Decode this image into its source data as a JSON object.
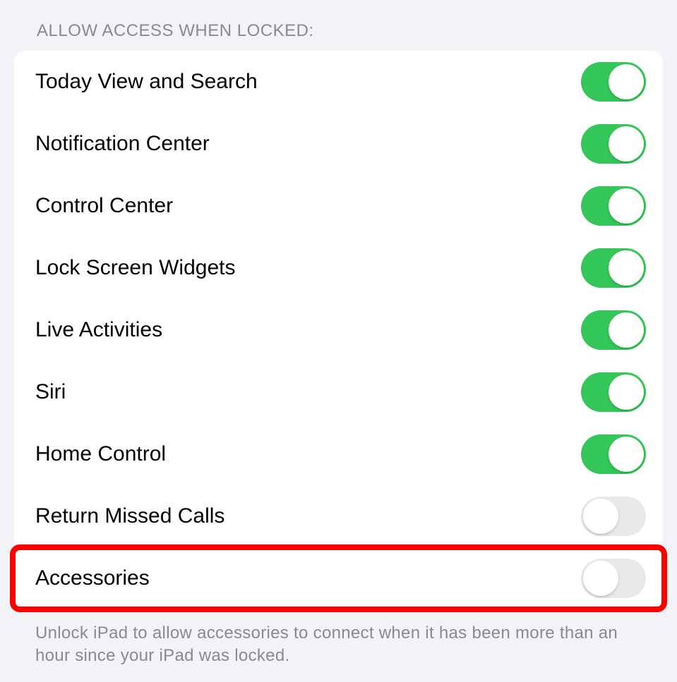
{
  "section": {
    "header": "ALLOW ACCESS WHEN LOCKED:",
    "footer": "Unlock iPad to allow accessories to connect when it has been more than an hour since your iPad was locked.",
    "items": [
      {
        "label": "Today View and Search",
        "enabled": true,
        "highlighted": false
      },
      {
        "label": "Notification Center",
        "enabled": true,
        "highlighted": false
      },
      {
        "label": "Control Center",
        "enabled": true,
        "highlighted": false
      },
      {
        "label": "Lock Screen Widgets",
        "enabled": true,
        "highlighted": false
      },
      {
        "label": "Live Activities",
        "enabled": true,
        "highlighted": false
      },
      {
        "label": "Siri",
        "enabled": true,
        "highlighted": false
      },
      {
        "label": "Home Control",
        "enabled": true,
        "highlighted": false
      },
      {
        "label": "Return Missed Calls",
        "enabled": false,
        "highlighted": false
      },
      {
        "label": "Accessories",
        "enabled": false,
        "highlighted": true
      }
    ]
  },
  "colors": {
    "toggle_on": "#34c759",
    "toggle_off": "#e9e9eb",
    "highlight": "#ff0000"
  }
}
